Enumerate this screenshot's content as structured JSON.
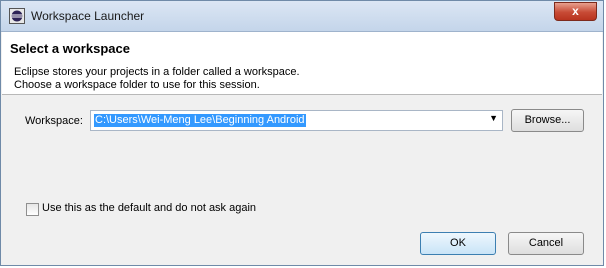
{
  "window": {
    "title": "Workspace Launcher",
    "close_glyph": "x",
    "app_icon": "eclipse-icon"
  },
  "header": {
    "title": "Select a workspace",
    "desc_line1": "Eclipse stores your projects in a folder called a workspace.",
    "desc_line2": "Choose a workspace folder to use for this session."
  },
  "workspace": {
    "label": "Workspace:",
    "value": "C:\\Users\\Wei-Meng Lee\\Beginning Android",
    "dropdown_icon": "chevron-down-icon",
    "browse_label": "Browse..."
  },
  "default_checkbox": {
    "label": "Use this as the default and do not ask again",
    "checked": false
  },
  "footer": {
    "ok_label": "OK",
    "cancel_label": "Cancel"
  },
  "colors": {
    "selection": "#3399ff",
    "close_button": "#c74a35"
  }
}
